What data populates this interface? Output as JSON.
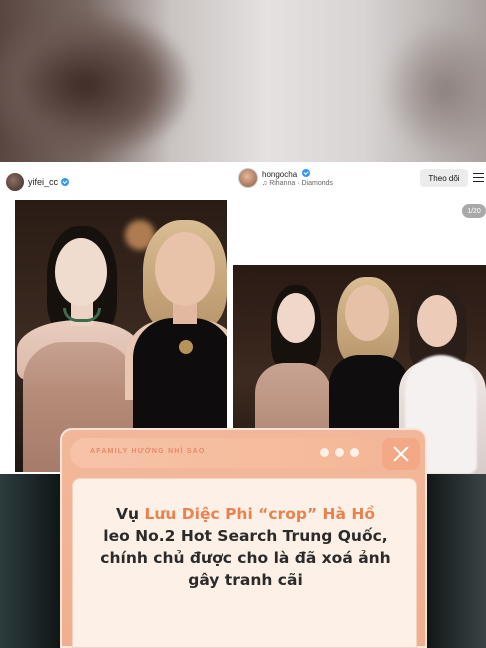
{
  "left_post": {
    "username": "yifei_cc"
  },
  "right_post": {
    "username": "hongocha",
    "music": "♫ Rihanna · Diamonds",
    "follow_label": "Theo dõi",
    "photo_counter": "1/20"
  },
  "card": {
    "source_label": "AFAMILY HƯỚNG NHÌ SAO",
    "headline": {
      "prefix": "Vụ ",
      "highlight": "Lưu Diệc Phi “crop” Hà Hồ",
      "line2": "leo No.2 Hot Search Trung Quốc,",
      "line3": "chính chủ được cho là đã xoá ảnh",
      "line4": "gây tranh cãi"
    }
  },
  "colors": {
    "card_orange": "#f0b08f",
    "highlight_orange": "#e9824f",
    "verified_blue": "#3797f0"
  }
}
